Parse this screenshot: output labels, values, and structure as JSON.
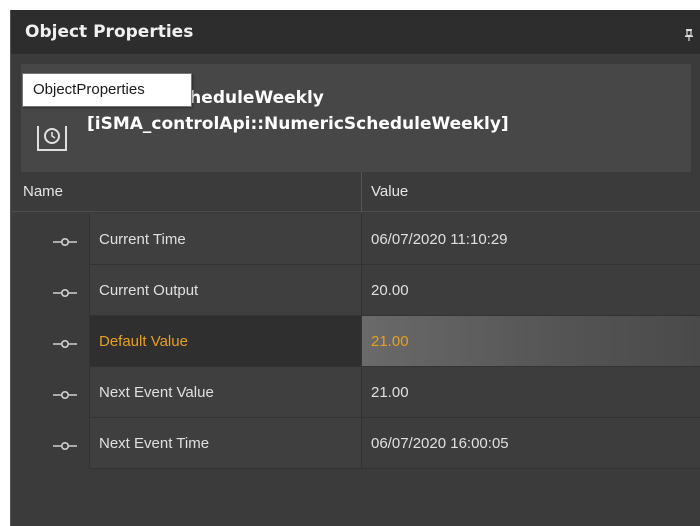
{
  "panel": {
    "title": "Object Properties",
    "pin_icon": "pin-icon"
  },
  "object": {
    "name": "NumericScheduleWeekly",
    "type": "[iSMA_controlApi::NumericScheduleWeekly]",
    "icon": "schedule-component-icon"
  },
  "tooltip": {
    "text": "ObjectProperties"
  },
  "grid": {
    "columns": {
      "name": "Name",
      "value": "Value"
    },
    "rows": [
      {
        "name": "Current Time",
        "value": "06/07/2020 11:10:29"
      },
      {
        "name": "Current Output",
        "value": "20.00"
      },
      {
        "name": "Default Value",
        "value": "21.00",
        "selected": true
      },
      {
        "name": "Next Event Value",
        "value": "21.00"
      },
      {
        "name": "Next Event Time",
        "value": "06/07/2020 16:00:05"
      }
    ],
    "connector_icon": "slot-connector-icon"
  },
  "colors": {
    "panel_bg": "#3b3b3b",
    "title_bg": "#2d2d2d",
    "selected_text": "#e8a020"
  }
}
